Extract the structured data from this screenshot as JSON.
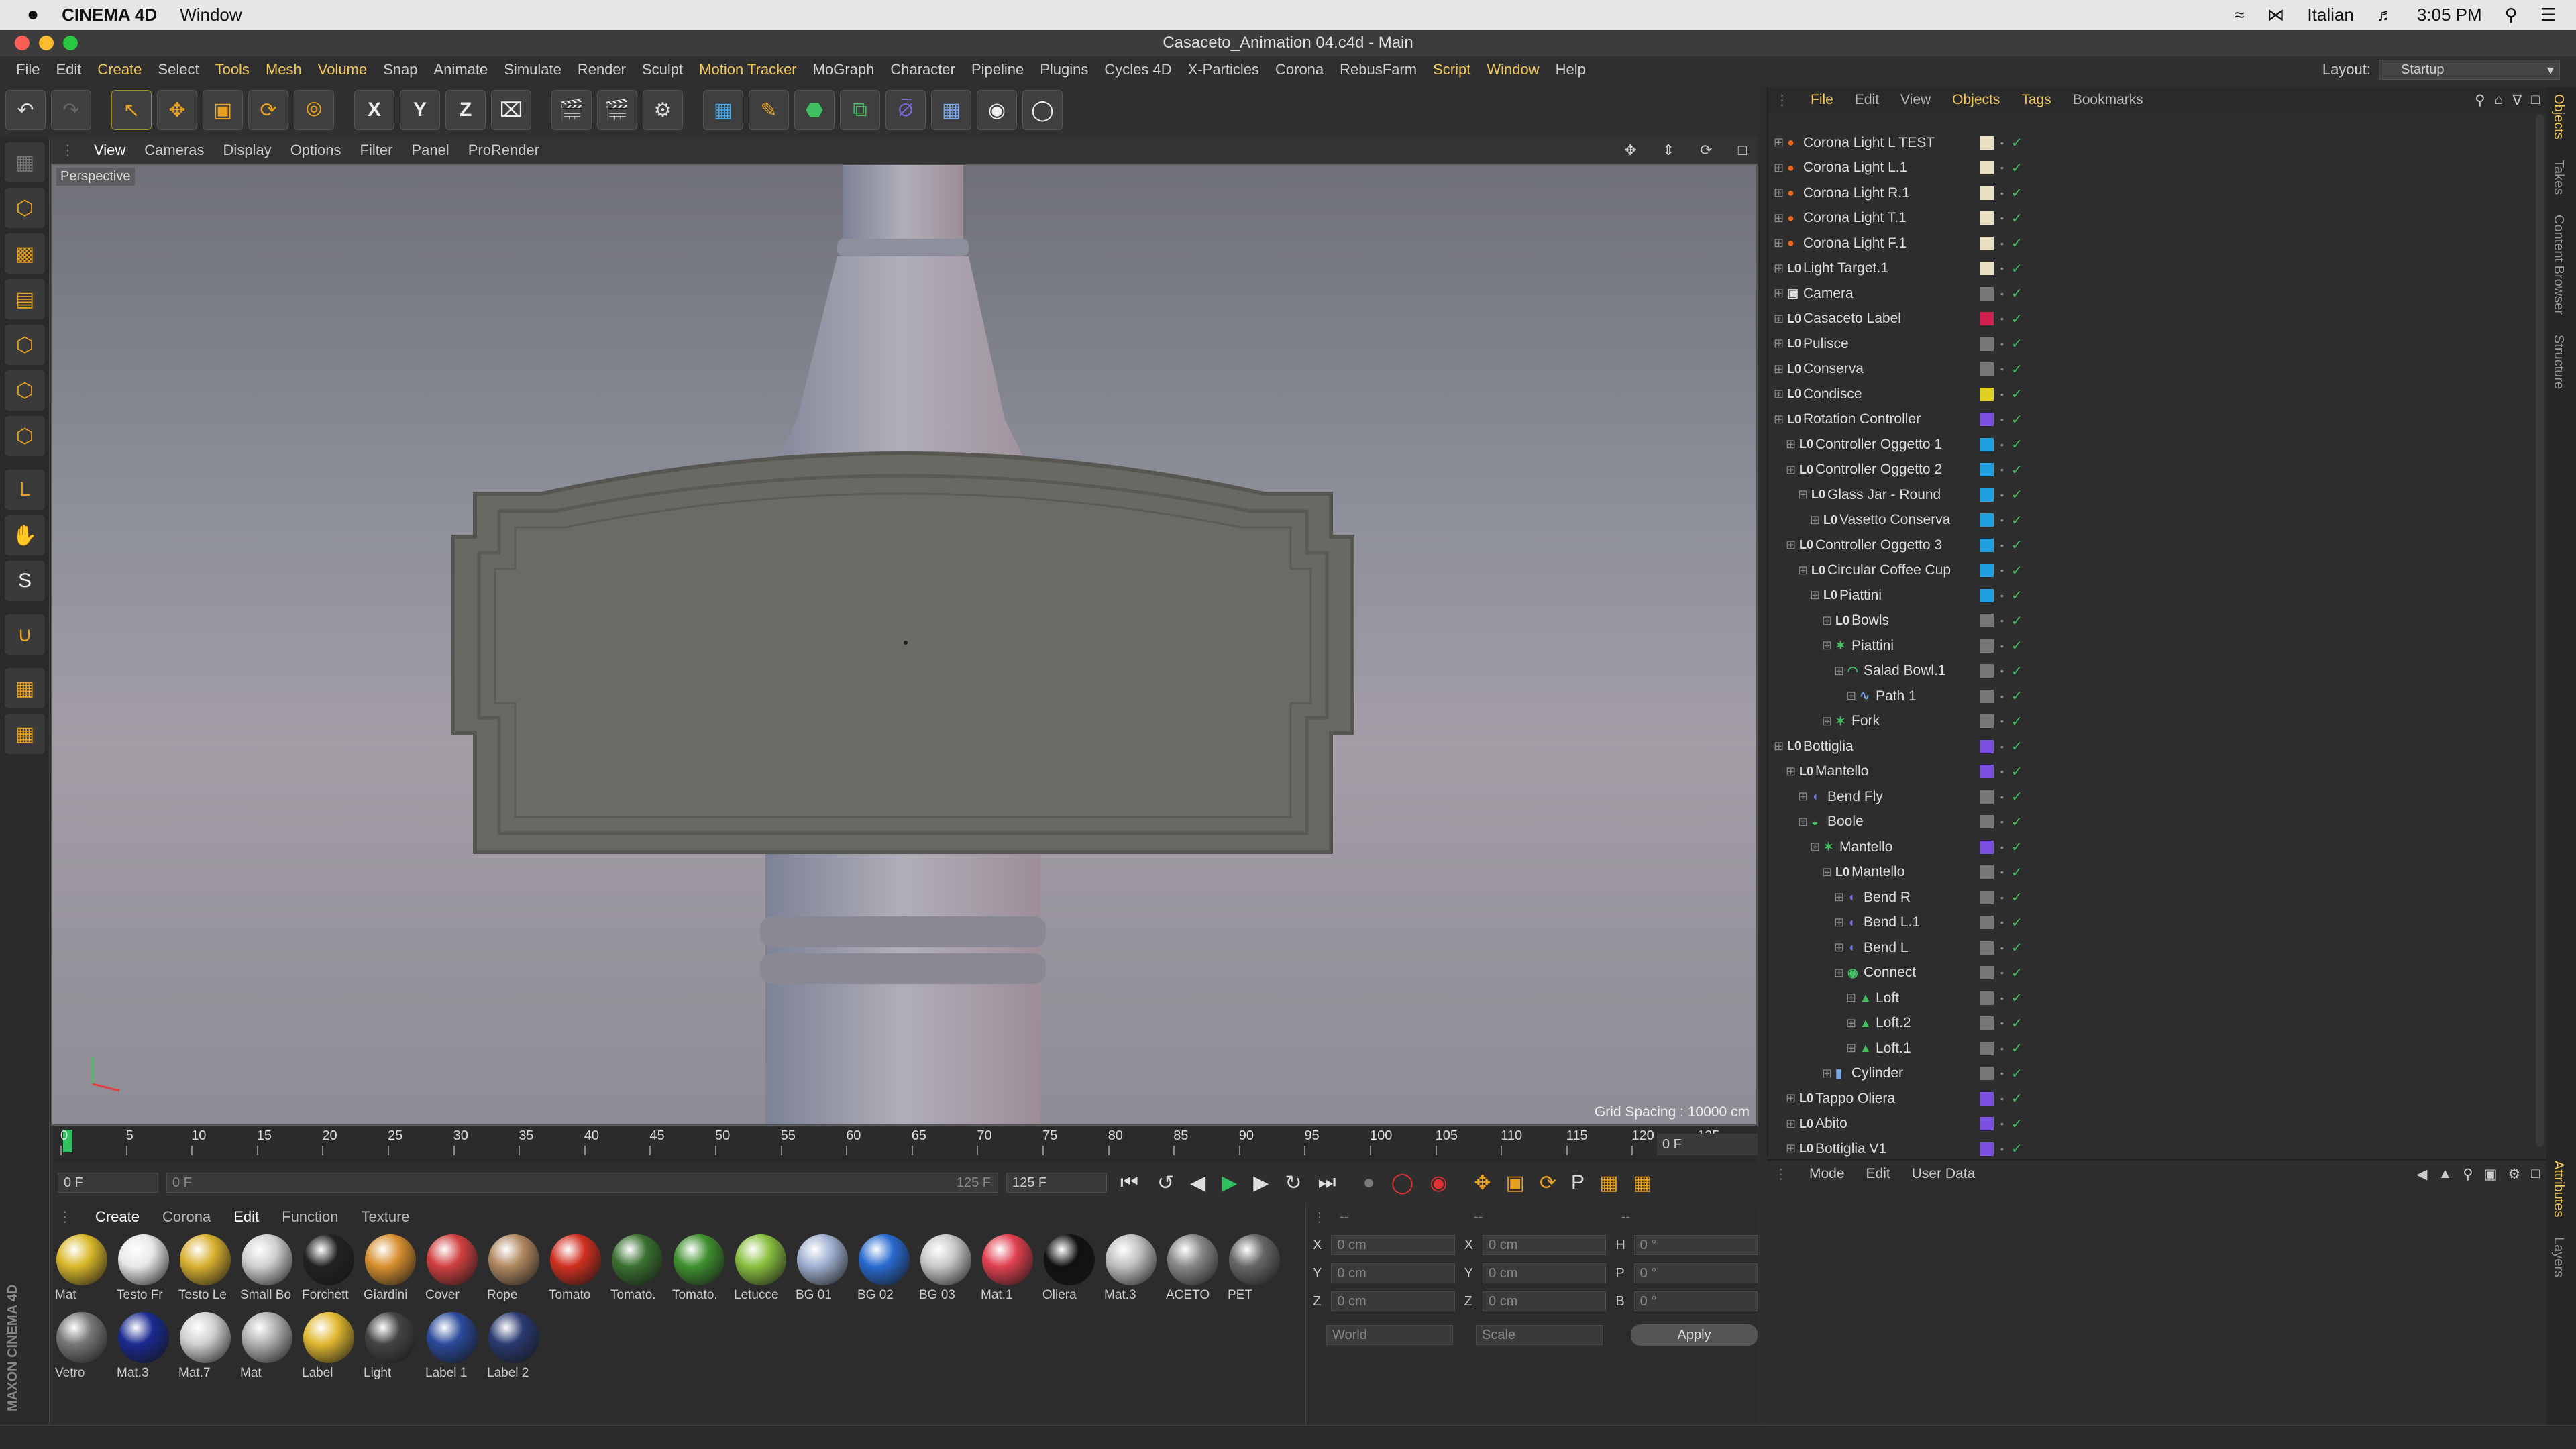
{
  "mac": {
    "apple_icon": "apple-icon",
    "app_name": "CINEMA 4D",
    "window_menu": "Window",
    "keyboard_lang": "Italian",
    "time": "3:05 PM"
  },
  "window": {
    "title": "Casaceto_Animation 04.c4d - Main"
  },
  "menu": [
    "File",
    "Edit",
    "Create",
    "Select",
    "Tools",
    "Mesh",
    "Volume",
    "Snap",
    "Animate",
    "Simulate",
    "Render",
    "Sculpt",
    "Motion Tracker",
    "MoGraph",
    "Character",
    "Pipeline",
    "Plugins",
    "Cycles 4D",
    "X-Particles",
    "Corona",
    "RebusFarm",
    "Script",
    "Window",
    "Help"
  ],
  "menu_highlighted": [
    "Create",
    "Tools",
    "Mesh",
    "Volume",
    "Motion Tracker",
    "Script",
    "Window"
  ],
  "layout": {
    "label": "Layout:",
    "value": "Startup"
  },
  "viewport": {
    "menu": [
      "View",
      "Cameras",
      "Display",
      "Options",
      "Filter",
      "Panel",
      "ProRender"
    ],
    "label": "Perspective",
    "grid_spacing": "Grid Spacing : 10000 cm"
  },
  "timeline": {
    "ticks": [
      "0",
      "5",
      "10",
      "15",
      "20",
      "25",
      "30",
      "35",
      "40",
      "45",
      "50",
      "55",
      "60",
      "65",
      "70",
      "75",
      "80",
      "85",
      "90",
      "95",
      "100",
      "105",
      "110",
      "115",
      "120",
      "125"
    ],
    "current_frame": "0 F"
  },
  "transport": {
    "start": "0 F",
    "range_start": "0 F",
    "range_end": "125 F",
    "end": "125 F"
  },
  "materials": {
    "menu": [
      "Create",
      "Corona",
      "Edit",
      "Function",
      "Texture"
    ],
    "items": [
      {
        "name": "Mat",
        "color": "#d9b82a"
      },
      {
        "name": "Testo Fr",
        "color": "#e8e8e8"
      },
      {
        "name": "Testo Le",
        "color": "#d8b030"
      },
      {
        "name": "Small Bo",
        "color": "#d0d0d0"
      },
      {
        "name": "Forchett",
        "color": "#222222"
      },
      {
        "name": "Giardini",
        "color": "#d89030"
      },
      {
        "name": "Cover",
        "color": "#d04040"
      },
      {
        "name": "Rope",
        "color": "#b08860"
      },
      {
        "name": "Tomato",
        "color": "#d03020"
      },
      {
        "name": "Tomato.",
        "color": "#3a7030"
      },
      {
        "name": "Tomato.",
        "color": "#409030"
      },
      {
        "name": "Letucce",
        "color": "#8ac040"
      },
      {
        "name": "BG 01",
        "color": "#a0b0d0"
      },
      {
        "name": "BG 02",
        "color": "#2a6ad0"
      },
      {
        "name": "BG 03",
        "color": "#c8c8c8"
      },
      {
        "name": "Mat.1",
        "color": "#e04050"
      },
      {
        "name": "Oliera",
        "color": "#111111"
      },
      {
        "name": "Mat.3",
        "color": "#c0c0c0"
      },
      {
        "name": "ACETO",
        "color": "#888888"
      },
      {
        "name": "PET",
        "color": "#666666"
      },
      {
        "name": "Vetro",
        "color": "#777777"
      },
      {
        "name": "Mat.3",
        "color": "#1a2a90"
      },
      {
        "name": "Mat.7",
        "color": "#d0d0d0"
      },
      {
        "name": "Mat",
        "color": "#b0b0b0"
      },
      {
        "name": "Label",
        "color": "#e0b830"
      },
      {
        "name": "Light",
        "color": "#444444"
      },
      {
        "name": "Label 1",
        "color": "#2a4a9a"
      },
      {
        "name": "Label 2",
        "color": "#2a3a70"
      }
    ]
  },
  "coords": {
    "headers": [
      "--",
      "--",
      "--"
    ],
    "rows": [
      {
        "a": "X",
        "av": "0 cm",
        "b": "X",
        "bv": "0 cm",
        "c": "H",
        "cv": "0 °"
      },
      {
        "a": "Y",
        "av": "0 cm",
        "b": "Y",
        "bv": "0 cm",
        "c": "P",
        "cv": "0 °"
      },
      {
        "a": "Z",
        "av": "0 cm",
        "b": "Z",
        "bv": "0 cm",
        "c": "B",
        "cv": "0 °"
      }
    ],
    "space": "World",
    "mode": "Scale",
    "apply": "Apply"
  },
  "objects": {
    "menu": [
      "File",
      "Edit",
      "View",
      "Objects",
      "Tags",
      "Bookmarks"
    ],
    "rows": [
      {
        "name": "Corona Light L TEST",
        "indent": 0,
        "icon": "light",
        "color": "#e8e0c0"
      },
      {
        "name": "Corona Light L.1",
        "indent": 0,
        "icon": "light",
        "color": "#e8e0c0"
      },
      {
        "name": "Corona Light R.1",
        "indent": 0,
        "icon": "light",
        "color": "#e8e0c0"
      },
      {
        "name": "Corona Light T.1",
        "indent": 0,
        "icon": "light",
        "color": "#e8e0c0"
      },
      {
        "name": "Corona Light F.1",
        "indent": 0,
        "icon": "light",
        "color": "#e8e0c0"
      },
      {
        "name": "Light Target.1",
        "indent": 0,
        "icon": "null",
        "color": "#e8e0c0"
      },
      {
        "name": "Camera",
        "indent": 0,
        "icon": "camera",
        "color": "#777777"
      },
      {
        "name": "Casaceto Label",
        "indent": 0,
        "icon": "null",
        "color": "#d02050"
      },
      {
        "name": "Pulisce",
        "indent": 0,
        "icon": "null",
        "color": "#777777"
      },
      {
        "name": "Conserva",
        "indent": 0,
        "icon": "null",
        "color": "#777777"
      },
      {
        "name": "Condisce",
        "indent": 0,
        "icon": "null",
        "color": "#e0d020"
      },
      {
        "name": "Rotation Controller",
        "indent": 0,
        "icon": "null",
        "color": "#7a50e0"
      },
      {
        "name": "Controller Oggetto 1",
        "indent": 1,
        "icon": "null",
        "color": "#20a0e0"
      },
      {
        "name": "Controller Oggetto 2",
        "indent": 1,
        "icon": "null",
        "color": "#20a0e0"
      },
      {
        "name": "Glass Jar - Round",
        "indent": 2,
        "icon": "null",
        "color": "#20a0e0"
      },
      {
        "name": "Vasetto Conserva",
        "indent": 3,
        "icon": "null",
        "color": "#20a0e0"
      },
      {
        "name": "Controller Oggetto 3",
        "indent": 1,
        "icon": "null",
        "color": "#20a0e0"
      },
      {
        "name": "Circular Coffee Cup",
        "indent": 2,
        "icon": "null",
        "color": "#20a0e0"
      },
      {
        "name": "Piattini",
        "indent": 3,
        "icon": "null",
        "color": "#20a0e0"
      },
      {
        "name": "Bowls",
        "indent": 4,
        "icon": "null",
        "color": "#777777"
      },
      {
        "name": "Piattini",
        "indent": 4,
        "icon": "cloner",
        "color": "#777777"
      },
      {
        "name": "Salad Bowl.1",
        "indent": 5,
        "icon": "lathe",
        "color": "#777777"
      },
      {
        "name": "Path 1",
        "indent": 6,
        "icon": "spline",
        "color": "#777777"
      },
      {
        "name": "Fork",
        "indent": 4,
        "icon": "cloner",
        "color": "#777777"
      },
      {
        "name": "Bottiglia",
        "indent": 0,
        "icon": "null",
        "color": "#7a50e0"
      },
      {
        "name": "Mantello",
        "indent": 1,
        "icon": "null",
        "color": "#7a50e0"
      },
      {
        "name": "Bend Fly",
        "indent": 2,
        "icon": "deformer",
        "color": "#777777"
      },
      {
        "name": "Boole",
        "indent": 2,
        "icon": "boole",
        "color": "#777777"
      },
      {
        "name": "Mantello",
        "indent": 3,
        "icon": "cloner",
        "color": "#7a50e0"
      },
      {
        "name": "Mantello",
        "indent": 4,
        "icon": "null",
        "color": "#777777"
      },
      {
        "name": "Bend R",
        "indent": 5,
        "icon": "deformer",
        "color": "#777777"
      },
      {
        "name": "Bend L.1",
        "indent": 5,
        "icon": "deformer",
        "color": "#777777"
      },
      {
        "name": "Bend L",
        "indent": 5,
        "icon": "deformer",
        "color": "#777777"
      },
      {
        "name": "Connect",
        "indent": 5,
        "icon": "connect",
        "color": "#777777"
      },
      {
        "name": "Loft",
        "indent": 6,
        "icon": "loft",
        "color": "#777777"
      },
      {
        "name": "Loft.2",
        "indent": 6,
        "icon": "loft",
        "color": "#777777"
      },
      {
        "name": "Loft.1",
        "indent": 6,
        "icon": "loft",
        "color": "#777777"
      },
      {
        "name": "Cylinder",
        "indent": 4,
        "icon": "cylinder",
        "color": "#777777"
      },
      {
        "name": "Tappo Oliera",
        "indent": 1,
        "icon": "null",
        "color": "#7a50e0"
      },
      {
        "name": "Abito",
        "indent": 1,
        "icon": "null",
        "color": "#7a50e0"
      },
      {
        "name": "Bottiglia V1",
        "indent": 1,
        "icon": "null",
        "color": "#7a50e0"
      }
    ]
  },
  "attributes": {
    "menu": [
      "Mode",
      "Edit",
      "User Data"
    ]
  },
  "side_tabs": [
    "Objects",
    "Takes",
    "Content Browser",
    "Structure"
  ],
  "attr_side_tabs": [
    "Attributes",
    "Layers"
  ],
  "brand": "MAXON CINEMA 4D"
}
